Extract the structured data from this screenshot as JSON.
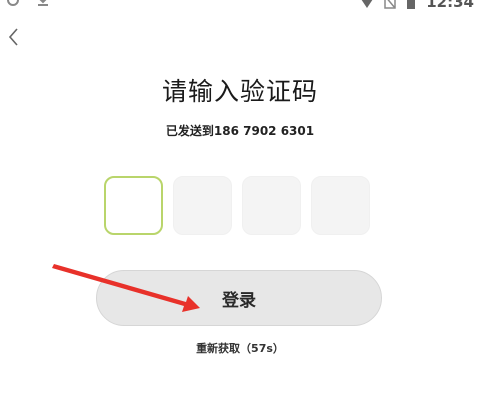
{
  "status_bar": {
    "time": "12:34",
    "icons": [
      "settings-icon",
      "download-icon",
      "wifi-icon",
      "no-sim-icon",
      "battery-icon"
    ]
  },
  "header": {
    "back_icon": "chevron-left-icon"
  },
  "title": "请输入验证码",
  "subtitle": "已发送到186 7902 6301",
  "code_inputs": [
    {
      "value": "",
      "active": true
    },
    {
      "value": "",
      "active": false
    },
    {
      "value": "",
      "active": false
    },
    {
      "value": "",
      "active": false
    }
  ],
  "login_button": {
    "label": "登录"
  },
  "resend": {
    "label": "重新获取（57s）"
  },
  "colors": {
    "accent_border": "#b9d56b",
    "annotation_arrow": "#e8312a",
    "button_bg": "#e7e7e7"
  }
}
